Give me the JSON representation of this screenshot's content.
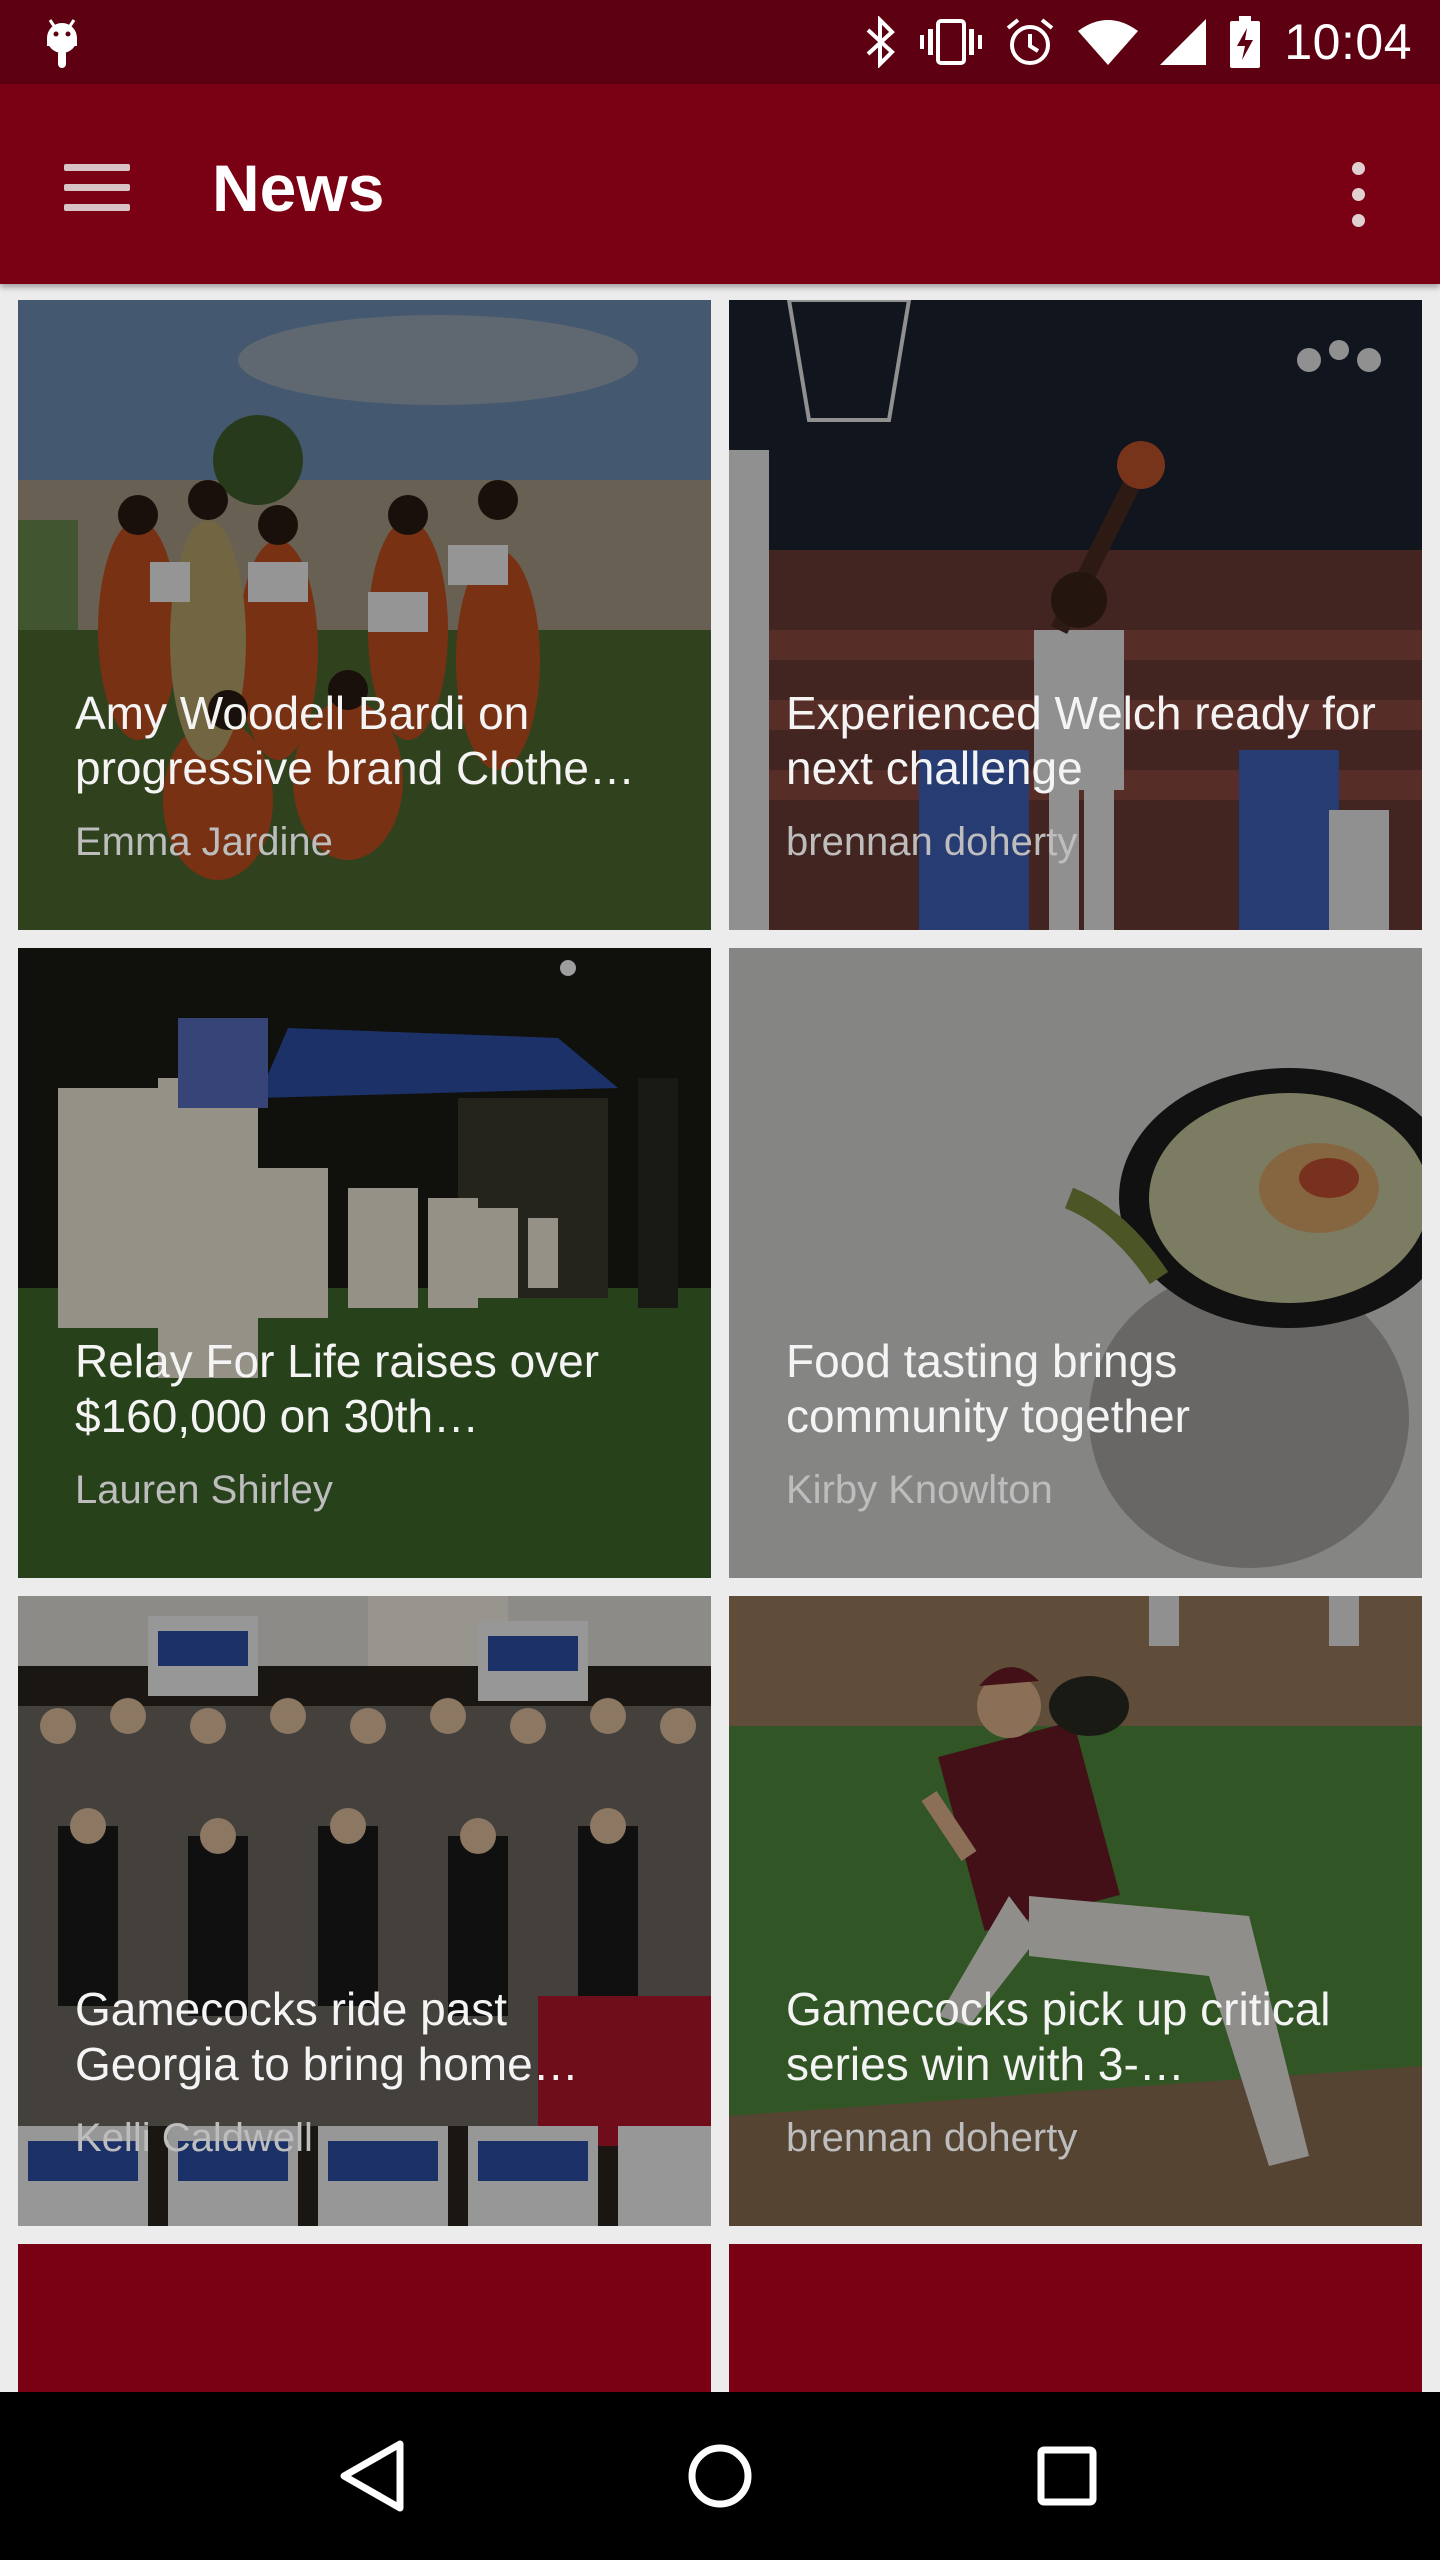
{
  "status_bar": {
    "time": "10:04",
    "icons": [
      "android-debug-icon",
      "bluetooth-icon",
      "vibrate-icon",
      "alarm-icon",
      "wifi-icon",
      "signal-icon",
      "battery-charging-icon"
    ]
  },
  "app_bar": {
    "title": "News",
    "menu_icon": "hamburger-menu-icon",
    "overflow_icon": "more-vert-icon"
  },
  "articles": [
    {
      "title": "Amy Woodell Bardi on progressive brand Clothe…",
      "author": "Emma Jardine"
    },
    {
      "title": "Experienced Welch ready for next challenge",
      "author": "brennan doherty"
    },
    {
      "title": "Relay For Life raises over $160,000 on 30th…",
      "author": "Lauren Shirley"
    },
    {
      "title": "Food tasting brings community together",
      "author": "Kirby Knowlton"
    },
    {
      "title": "Gamecocks ride past Georgia to bring home…",
      "author": "Kelli Caldwell"
    },
    {
      "title": "Gamecocks pick up critical series win with 3-…",
      "author": "brennan doherty"
    }
  ],
  "colors": {
    "primary": "#7a0014",
    "primary_dark": "#5c0012",
    "background": "#ececec"
  },
  "nav_bar": {
    "icons": [
      "back-icon",
      "home-icon",
      "recents-icon"
    ]
  }
}
